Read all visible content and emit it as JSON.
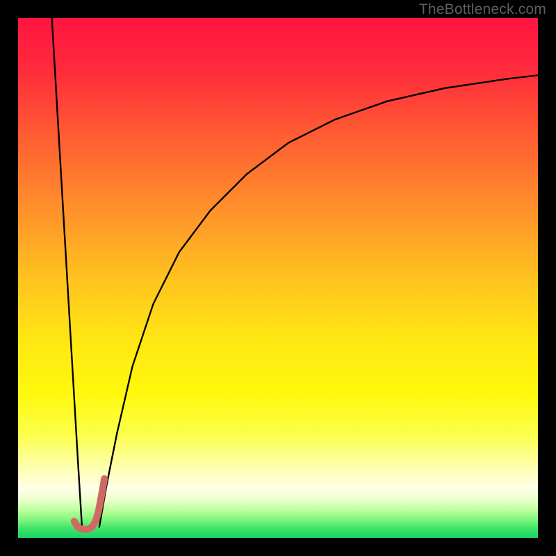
{
  "watermark": {
    "text": "TheBottleneck.com"
  },
  "gradient": {
    "stops": [
      {
        "offset": 0.0,
        "color": "#ff1440"
      },
      {
        "offset": 0.1,
        "color": "#ff2b3b"
      },
      {
        "offset": 0.22,
        "color": "#ff5a33"
      },
      {
        "offset": 0.35,
        "color": "#ff8a2c"
      },
      {
        "offset": 0.5,
        "color": "#ffc21f"
      },
      {
        "offset": 0.62,
        "color": "#ffe714"
      },
      {
        "offset": 0.72,
        "color": "#fff80c"
      },
      {
        "offset": 0.8,
        "color": "#fcff4a"
      },
      {
        "offset": 0.86,
        "color": "#fdffa8"
      },
      {
        "offset": 0.905,
        "color": "#ffffe8"
      },
      {
        "offset": 0.928,
        "color": "#e8ffc8"
      },
      {
        "offset": 0.948,
        "color": "#b8ff9a"
      },
      {
        "offset": 0.966,
        "color": "#7cf57c"
      },
      {
        "offset": 0.982,
        "color": "#3fe36a"
      },
      {
        "offset": 1.0,
        "color": "#17d363"
      }
    ]
  },
  "chart_data": {
    "type": "line",
    "title": "",
    "xlabel": "",
    "ylabel": "",
    "xlim": [
      0,
      100
    ],
    "ylim": [
      0,
      100
    ],
    "series": [
      {
        "name": "left-branch",
        "x": [
          6.5,
          7.5,
          8.5,
          9.5,
          10.5,
          11.5,
          12.3
        ],
        "values": [
          100,
          83,
          66,
          49,
          32,
          15,
          2
        ],
        "stroke": "#000000",
        "width": 2.4
      },
      {
        "name": "right-branch",
        "x": [
          15.6,
          17,
          19,
          22,
          26,
          31,
          37,
          44,
          52,
          61,
          71,
          82,
          94,
          100
        ],
        "values": [
          2,
          10,
          20,
          33,
          45,
          55,
          63,
          70,
          76,
          80.5,
          84,
          86.5,
          88.3,
          89
        ],
        "stroke": "#000000",
        "width": 2.4
      },
      {
        "name": "highlight-hook",
        "x": [
          10.8,
          11.4,
          12.0,
          12.8,
          13.6,
          14.3,
          14.9,
          15.4,
          15.8,
          16.2,
          16.6
        ],
        "values": [
          3.2,
          2.2,
          1.8,
          1.6,
          1.7,
          2.2,
          3.2,
          4.8,
          6.8,
          9.0,
          11.4
        ],
        "stroke": "#cf6a62",
        "width": 10,
        "linecap": "round"
      }
    ]
  }
}
